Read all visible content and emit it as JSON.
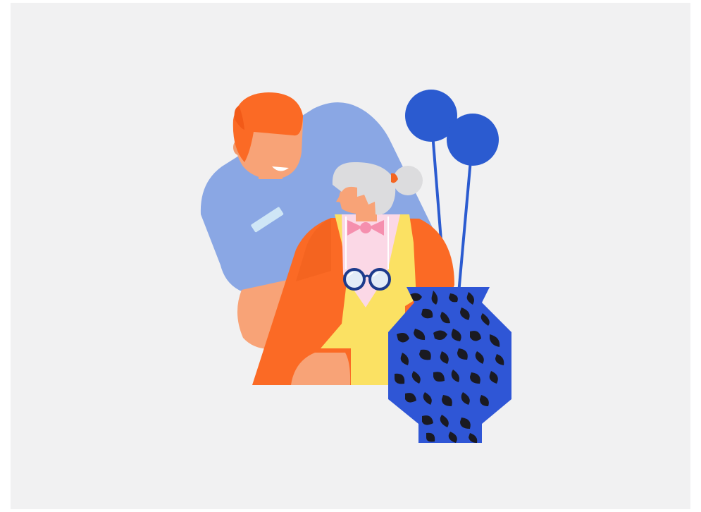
{
  "illustration": {
    "background_color": "#f1f1f2",
    "colors": {
      "caregiver_hair": "#fb6a25",
      "skin": "#f8a377",
      "caregiver_shirt": "#8aa7e4",
      "name_badge": "#cfe6f6",
      "elder_hair": "#dcdcde",
      "bow_tie": "#f58fae",
      "cardigan": "#fb6a25",
      "vest": "#fbe163",
      "blouse": "#fbd8e6",
      "glasses_frame": "#1e3b8c",
      "vase_base": "#2f56d6",
      "vase_pattern": "#1a1a22",
      "flower": "#2b5bd0"
    },
    "icons": [
      "caregiver-figure",
      "elderly-woman-figure",
      "glasses-icon",
      "flower-vase"
    ]
  }
}
